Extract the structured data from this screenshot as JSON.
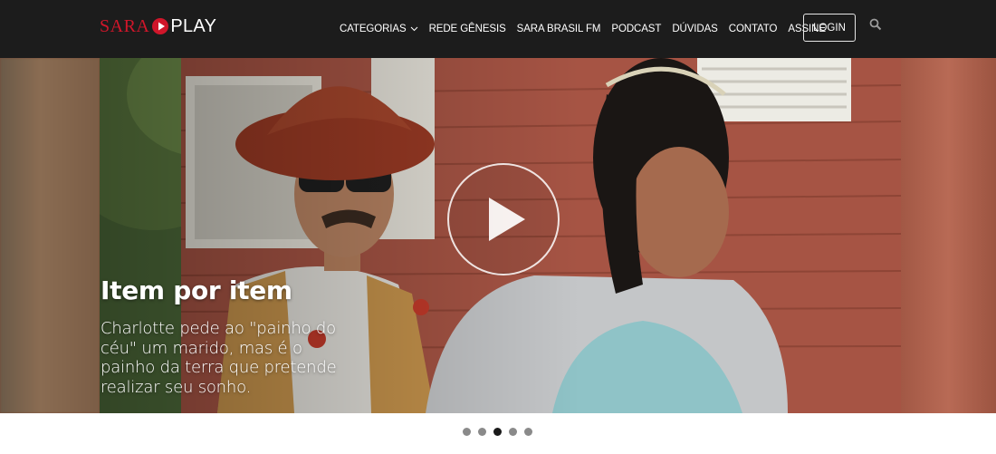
{
  "brand": {
    "name_part1": "SARA",
    "name_part2": "PLAY",
    "accent": "#d0162a"
  },
  "nav": {
    "items": [
      {
        "label": "CATEGORIAS",
        "has_dropdown": true
      },
      {
        "label": "REDE GÊNESIS"
      },
      {
        "label": "SARA BRASIL FM"
      },
      {
        "label": "PODCAST"
      },
      {
        "label": "DÚVIDAS"
      },
      {
        "label": "CONTATO"
      },
      {
        "label": "ASSINE"
      }
    ],
    "login_label": "LOGIN",
    "search_icon": "search-icon",
    "dropdown_icon": "chevron-down-icon"
  },
  "hero": {
    "title": "Item por item",
    "description": "Charlotte pede ao \"painho do céu\" um marido, mas é o painho da terra que pretende realizar seu sonho.",
    "play_icon": "play-icon"
  },
  "carousel": {
    "slides": 5,
    "active_index": 2
  },
  "colors": {
    "header_bg": "#1c1c1c",
    "dot": "#8a8a8a",
    "dot_active": "#1a1a1a"
  }
}
